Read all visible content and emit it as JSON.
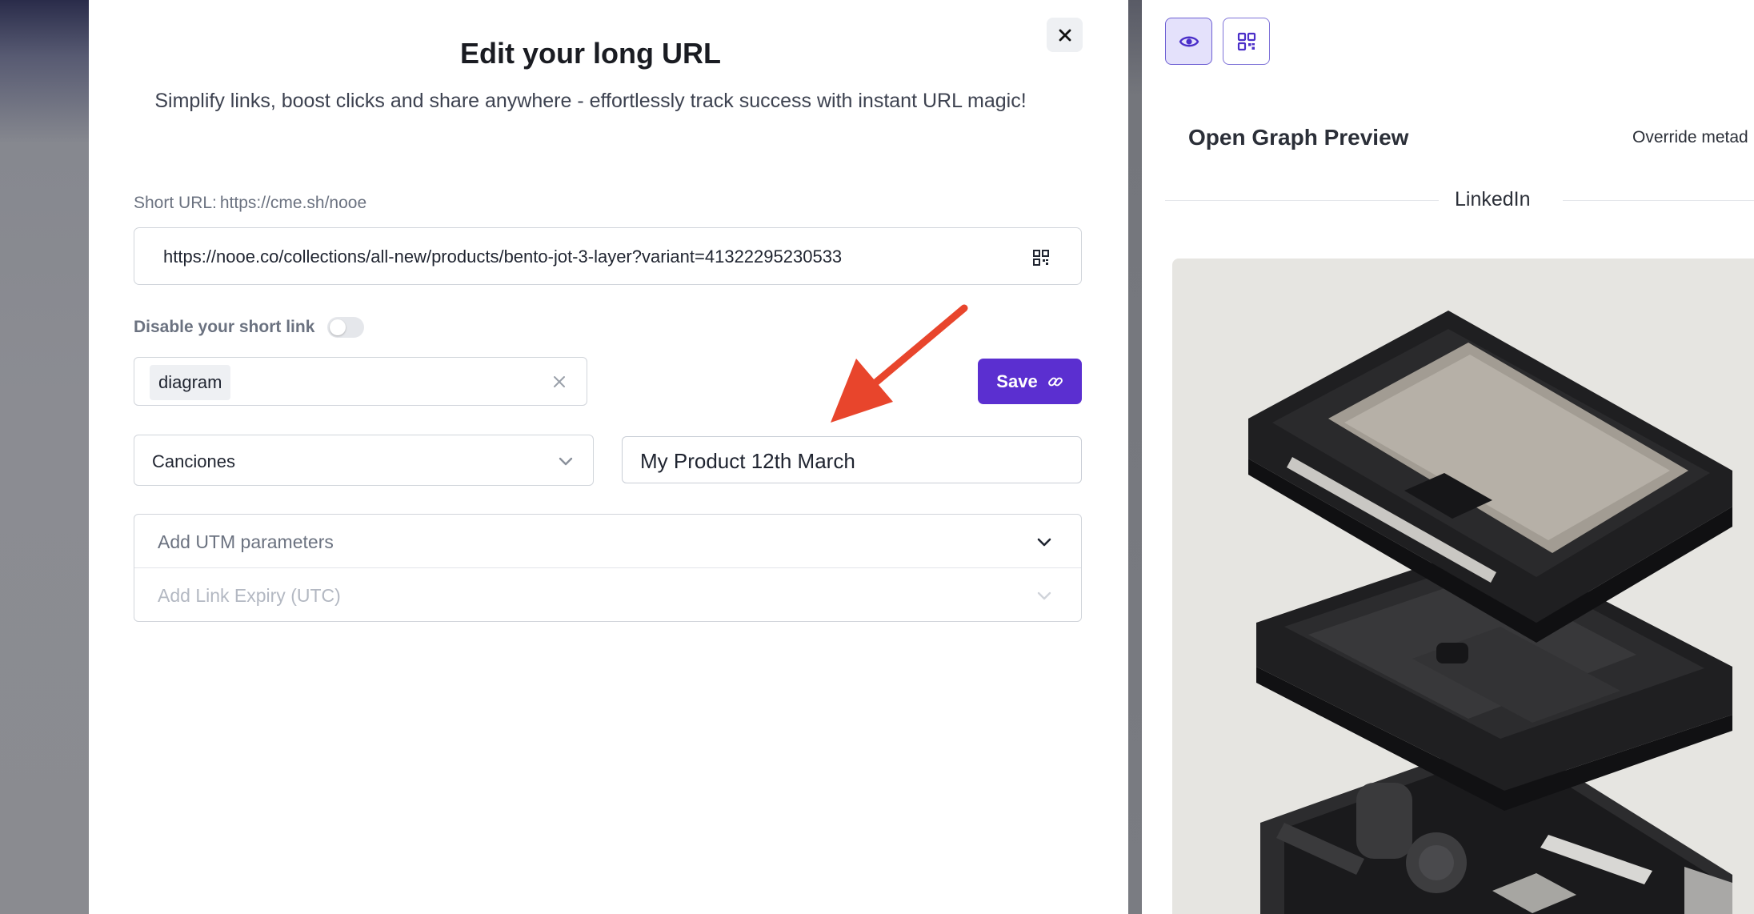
{
  "modal": {
    "title": "Edit your long URL",
    "subtitle": "Simplify links, boost clicks and share anywhere - effortlessly track success with instant URL magic!",
    "short_url_label": "Short URL:",
    "short_url_value": "https://cme.sh/nooe",
    "long_url": "https://nooe.co/collections/all-new/products/bento-jot-3-layer?variant=41322295230533",
    "disable_label": "Disable your short link",
    "disable_enabled": false,
    "tag_value": "diagram",
    "save_label": "Save",
    "folder_selected": "Canciones",
    "link_title_value": "My Product 12th March",
    "utm_label": "Add UTM parameters",
    "expiry_label": "Add Link Expiry (UTC)"
  },
  "panel": {
    "og_title": "Open Graph Preview",
    "override_label": "Override metad",
    "platform_label": "LinkedIn"
  },
  "icons": {
    "close": "close-icon",
    "qr": "qr-code-icon",
    "clear": "clear-x-icon",
    "link": "link-icon",
    "chevron": "chevron-down-icon",
    "eye": "eye-icon"
  },
  "colors": {
    "primary": "#5b2fd0",
    "annotation_arrow": "#e8452c",
    "preview_bg": "#e6e5e1"
  }
}
